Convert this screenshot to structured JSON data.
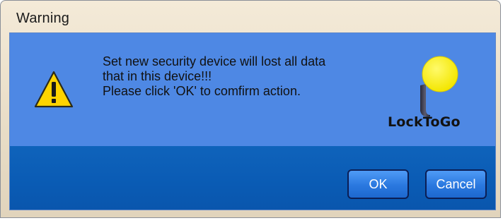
{
  "window": {
    "title": "Warning"
  },
  "message": {
    "lines": [
      "Set new security device will lost all data",
      "that in this device!!!",
      "Please click 'OK' to comfirm action."
    ]
  },
  "logo": {
    "text": "LockToGo"
  },
  "buttons": {
    "ok_label": "OK",
    "cancel_label": "Cancel"
  },
  "icons": {
    "warning": "warning-triangle-icon",
    "logo": "yellow-pin-logo"
  },
  "colors": {
    "upper_panel": "#4e88e4",
    "lower_panel": "#0a5bb4",
    "button_border": "#0b1e55",
    "warning_yellow": "#ffd400",
    "logo_yellow": "#f6ee1c"
  }
}
